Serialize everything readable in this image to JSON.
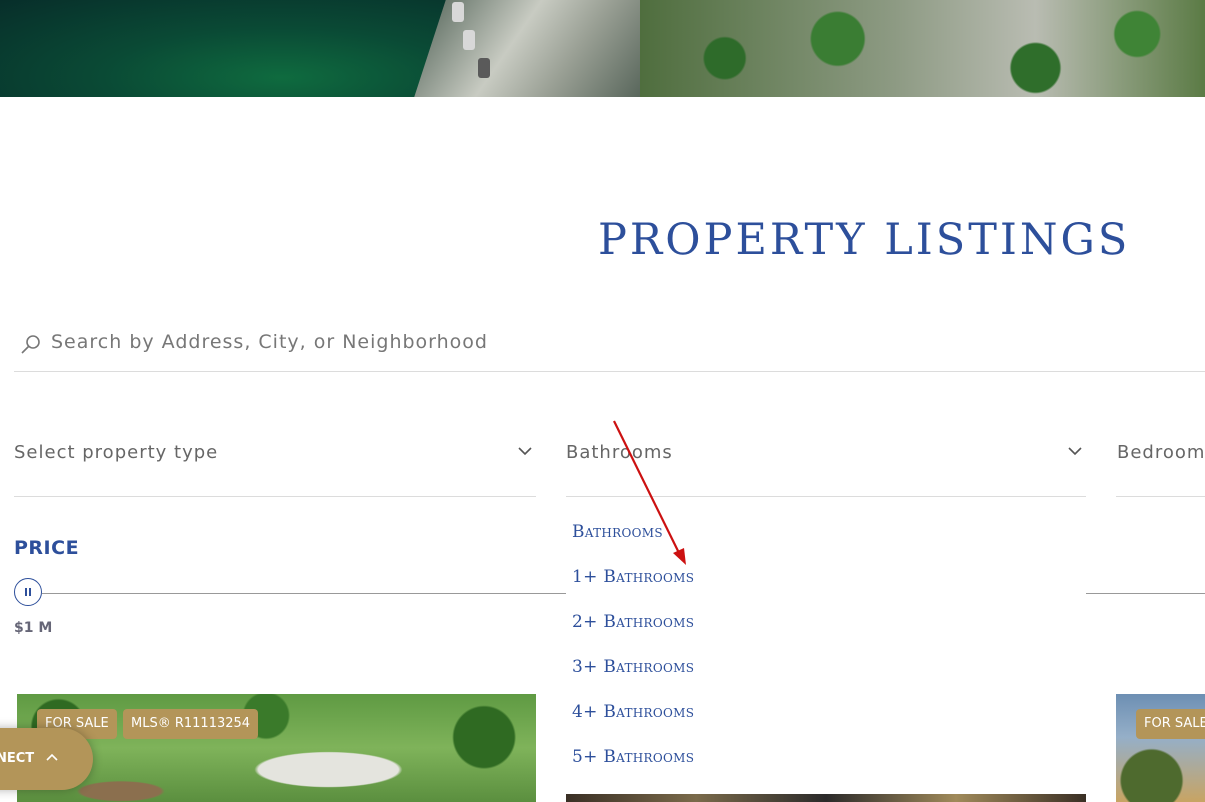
{
  "page": {
    "title": "PROPERTY LISTINGS"
  },
  "search": {
    "placeholder": "Search by Address, City, or Neighborhood",
    "icon": "search-icon"
  },
  "filters": {
    "property_type": {
      "placeholder": "Select property type"
    },
    "bathrooms": {
      "placeholder": "Bathrooms",
      "open": true,
      "options": [
        "Bathrooms",
        "1+ Bathrooms",
        "2+ Bathrooms",
        "3+ Bathrooms",
        "4+ Bathrooms",
        "5+ Bathrooms"
      ]
    },
    "bedrooms": {
      "placeholder": "Bedrooms"
    }
  },
  "price": {
    "label": "PRICE",
    "value": "$1 M"
  },
  "listings": [
    {
      "status": "FOR SALE",
      "mls": "MLS® R11113254"
    },
    {
      "status": "FOR SALE"
    }
  ],
  "connect_button": {
    "label": "NECT"
  },
  "colors": {
    "brand_blue": "#2d4f9b",
    "gold": "#b39559",
    "annotation_red": "#cc1111"
  }
}
